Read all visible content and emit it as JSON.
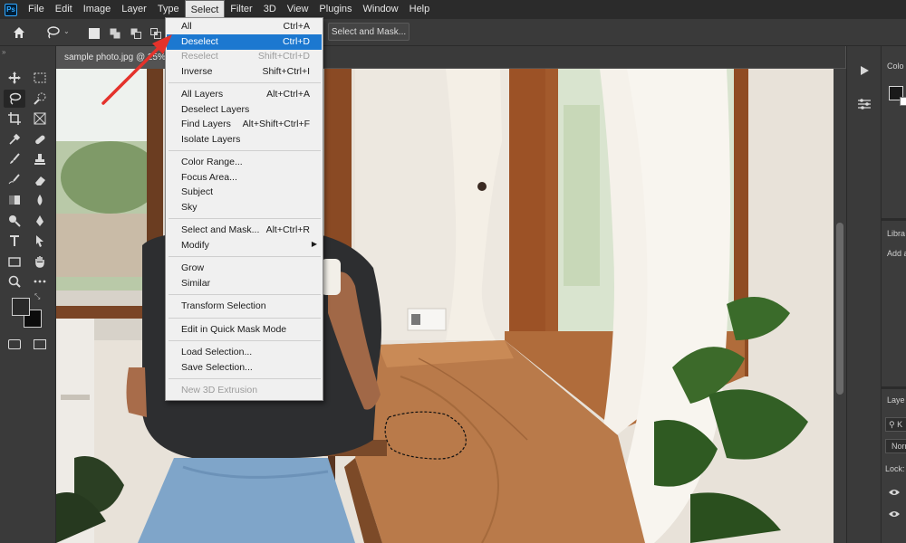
{
  "app_logo": "Ps",
  "menubar": [
    "File",
    "Edit",
    "Image",
    "Layer",
    "Type",
    "Select",
    "Filter",
    "3D",
    "View",
    "Plugins",
    "Window",
    "Help"
  ],
  "active_menu": "Select",
  "options_bar": {
    "select_and_mask": "Select and Mask..."
  },
  "document_tab": "sample photo.jpg @ 25%",
  "right_panels": {
    "color_label": "Colo",
    "libraries_label": "Libra",
    "libraries_add": "Add a",
    "layers_label": "Laye",
    "layers_filter": "K",
    "blend_mode": "Norm",
    "lock_label": "Lock:"
  },
  "select_menu": [
    {
      "label": "All",
      "shortcut": "Ctrl+A"
    },
    {
      "label": "Deselect",
      "shortcut": "Ctrl+D",
      "highlighted": true
    },
    {
      "label": "Reselect",
      "shortcut": "Shift+Ctrl+D",
      "disabled": true
    },
    {
      "label": "Inverse",
      "shortcut": "Shift+Ctrl+I"
    },
    {
      "separator": true
    },
    {
      "label": "All Layers",
      "shortcut": "Alt+Ctrl+A"
    },
    {
      "label": "Deselect Layers",
      "shortcut": ""
    },
    {
      "label": "Find Layers",
      "shortcut": "Alt+Shift+Ctrl+F"
    },
    {
      "label": "Isolate Layers",
      "shortcut": ""
    },
    {
      "separator": true
    },
    {
      "label": "Color Range...",
      "shortcut": ""
    },
    {
      "label": "Focus Area...",
      "shortcut": ""
    },
    {
      "label": "Subject",
      "shortcut": ""
    },
    {
      "label": "Sky",
      "shortcut": ""
    },
    {
      "separator": true
    },
    {
      "label": "Select and Mask...",
      "shortcut": "Alt+Ctrl+R"
    },
    {
      "label": "Modify",
      "shortcut": "",
      "submenu": true
    },
    {
      "separator": true
    },
    {
      "label": "Grow",
      "shortcut": ""
    },
    {
      "label": "Similar",
      "shortcut": ""
    },
    {
      "separator": true
    },
    {
      "label": "Transform Selection",
      "shortcut": ""
    },
    {
      "separator": true
    },
    {
      "label": "Edit in Quick Mask Mode",
      "shortcut": ""
    },
    {
      "separator": true
    },
    {
      "label": "Load Selection...",
      "shortcut": ""
    },
    {
      "label": "Save Selection...",
      "shortcut": ""
    },
    {
      "separator": true
    },
    {
      "label": "New 3D Extrusion",
      "shortcut": "",
      "disabled": true
    }
  ],
  "tools": [
    "move-tool",
    "marquee-tool",
    "lasso-tool",
    "quick-select-tool",
    "crop-tool",
    "frame-tool",
    "eyedropper-tool",
    "healing-tool",
    "brush-tool",
    "stamp-tool",
    "history-brush-tool",
    "eraser-tool",
    "gradient-tool",
    "blur-tool",
    "dodge-tool",
    "pen-tool",
    "type-tool",
    "path-select-tool",
    "rectangle-tool",
    "hand-tool",
    "zoom-tool",
    "more-tools"
  ],
  "colors": {
    "accent": "#1c78d0",
    "arrow": "#e4322b",
    "foreground_swatch": "#2a2a2a",
    "background_swatch": "#0c0c0c"
  }
}
